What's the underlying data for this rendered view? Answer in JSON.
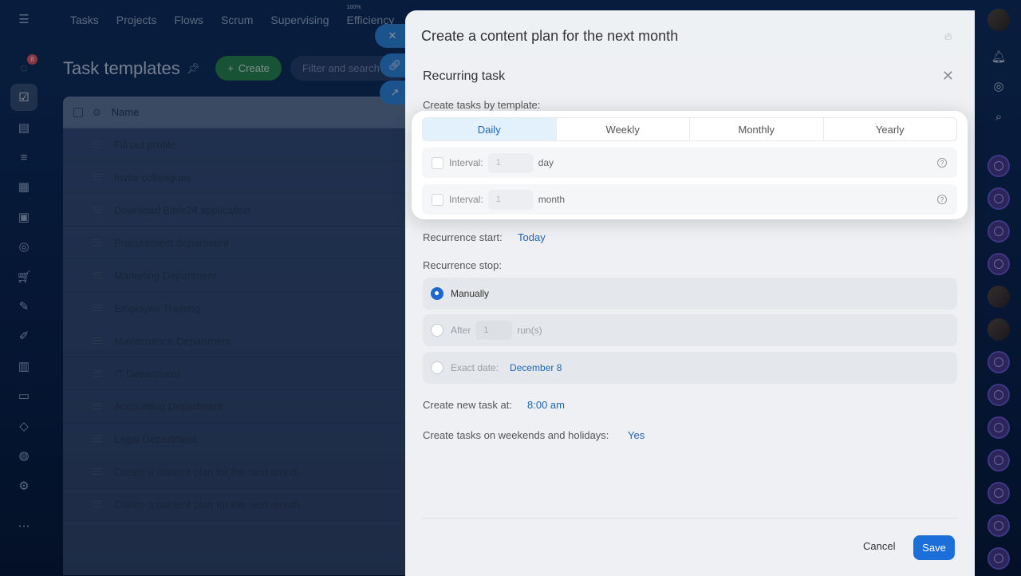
{
  "topnav": [
    "Tasks",
    "Projects",
    "Flows",
    "Scrum",
    "Supervising",
    "Efficiency"
  ],
  "efficiency_value": "100%",
  "page": {
    "title": "Task templates",
    "create_label": "Create",
    "filter_placeholder": "Filter and search"
  },
  "table": {
    "header_name": "Name",
    "rows": [
      "Fill out profile",
      "Invite colleagues",
      "Download Bitrix24 application",
      "Procurement department",
      "Marketing Department",
      "Employee Training",
      "Maintenance Department",
      "IT Department",
      "Accounting Department",
      "Legal Department",
      "Create a content plan for the next month",
      "Create a content plan for the next month"
    ]
  },
  "rail": {
    "notification_count": "8"
  },
  "task_panel": {
    "title": "Create a content plan for the next month"
  },
  "recurring": {
    "title": "Recurring task",
    "by_template_label": "Create tasks by template:",
    "tabs": [
      "Daily",
      "Weekly",
      "Monthly",
      "Yearly"
    ],
    "selected_tab": "Daily",
    "interval_label": "Interval:",
    "interval_day_value": "1",
    "interval_day_unit": "day",
    "interval_month_value": "1",
    "interval_month_unit": "month",
    "start_label": "Recurrence start:",
    "start_value": "Today",
    "stop_label": "Recurrence stop:",
    "stop_manually": "Manually",
    "stop_after": "After",
    "stop_after_value": "1",
    "stop_after_unit": "run(s)",
    "stop_exact_date": "Exact date:",
    "stop_exact_date_value": "December 8",
    "create_at_label": "Create new task at:",
    "create_at_value": "8:00 am",
    "weekends_label": "Create tasks on weekends and holidays:",
    "weekends_value": "Yes",
    "cancel_label": "Cancel",
    "save_label": "Save"
  },
  "colors": {
    "accent": "#1c6fd8",
    "link": "#2066b0",
    "selected_tab_bg": "#e3f1fd",
    "create_green": "#2a8a4a"
  }
}
